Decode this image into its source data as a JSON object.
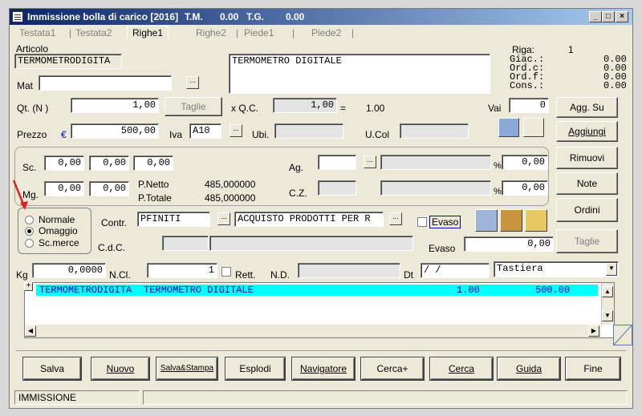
{
  "window": {
    "title": "Immissione bolla di carico [2016]",
    "tm_label": "T.M.",
    "tm_value": "0.00",
    "tg_label": "T.G.",
    "tg_value": "0.00"
  },
  "window_controls": {
    "minimize": "_",
    "maximize": "□",
    "close": "×"
  },
  "tabs": [
    {
      "label": "Testata1"
    },
    {
      "label": "Testata2"
    },
    {
      "label": "Righe1"
    },
    {
      "label": "Righe2"
    },
    {
      "label": "Piede1"
    },
    {
      "label": "Piede2"
    }
  ],
  "active_tab": "Righe1",
  "articolo": {
    "label": "Articolo",
    "code": "TERMOMETRODIGITA",
    "description": "TERMOMETRO DIGITALE"
  },
  "riga": {
    "label": "Riga:",
    "value": "1"
  },
  "stock": {
    "giac_label": "Giac.:",
    "giac": "0.00",
    "ordc_label": "Ord.c:",
    "ordc": "0.00",
    "ordf_label": "Ord.f:",
    "ordf": "0.00",
    "cons_label": "Cons.:",
    "cons": "0.00"
  },
  "mat": {
    "label": "Mat",
    "value": ""
  },
  "qt": {
    "label": "Qt. (N )",
    "value": "1,00",
    "taglie_button": "Taglie",
    "qc_label": "x  Q.C.",
    "qc_value": "1,00",
    "eq": "=",
    "result": "1.00"
  },
  "vai": {
    "label": "Vai",
    "value": "0"
  },
  "prezzo": {
    "label": "Prezzo",
    "currency": "€",
    "value": "500,00",
    "iva_label": "Iva",
    "iva_value": "A10",
    "ubi_label": "Ubi.",
    "ucol_label": "U.Col"
  },
  "sconti": {
    "sc_label": "Sc.",
    "sc": [
      "0,00",
      "0,00",
      "0,00"
    ],
    "mg_label": "Mg.",
    "mg": [
      "0,00",
      "0,00"
    ],
    "pnetto_label": "P.Netto",
    "pnetto": "485,000000",
    "ptotale_label": "P.Totale",
    "ptotale": "485,000000"
  },
  "agenti": {
    "ag_label": "Ag.",
    "ag_pct": "0,00",
    "cz_label": "C.Z.",
    "cz_pct": "0,00",
    "pct": "%"
  },
  "tipo": {
    "options": [
      "Normale",
      "Omaggio",
      "Sc.merce"
    ],
    "selected": "Omaggio"
  },
  "contr": {
    "label": "Contr.",
    "code": "PFINITI",
    "description": "ACQUISTO PRODOTTI PER R",
    "evaso_check": "Evaso"
  },
  "cdc": {
    "label": "C.d.C.",
    "evaso_label": "Evaso",
    "evaso_value": "0,00"
  },
  "kg": {
    "label": "Kg",
    "value": "0,0000",
    "ncl_label": "N.Cl.",
    "ncl_value": "1",
    "rett_label": "Rett.",
    "nd_label": "N.D.",
    "dt_label": "Dt",
    "dt_value": " /  /",
    "input_mode": "Tastiera"
  },
  "grid": {
    "rows": [
      {
        "code": "TERMOMETRODIGITA",
        "desc": "TERMOMETRO DIGITALE",
        "qty": "1.00",
        "price": "500.00"
      }
    ]
  },
  "side_buttons": {
    "agg_su": "Agg. Su",
    "aggiungi": "Aggiungi",
    "rimuovi": "Rimuovi",
    "note": "Note",
    "ordini": "Ordini",
    "taglie": "Taglie"
  },
  "bottom_buttons": [
    "Salva",
    "Nuovo",
    "Salva&Stampa",
    "Esplodi",
    "Navigatore",
    "Cerca+",
    "Cerca",
    "Guida",
    "Fine"
  ],
  "status": {
    "mode": "IMMISSIONE",
    "info": ""
  },
  "colors": {
    "title_start": "#0a246a",
    "title_end": "#a6caf0",
    "selected_row": "#00ffff",
    "window_bg": "#ece9d8"
  }
}
